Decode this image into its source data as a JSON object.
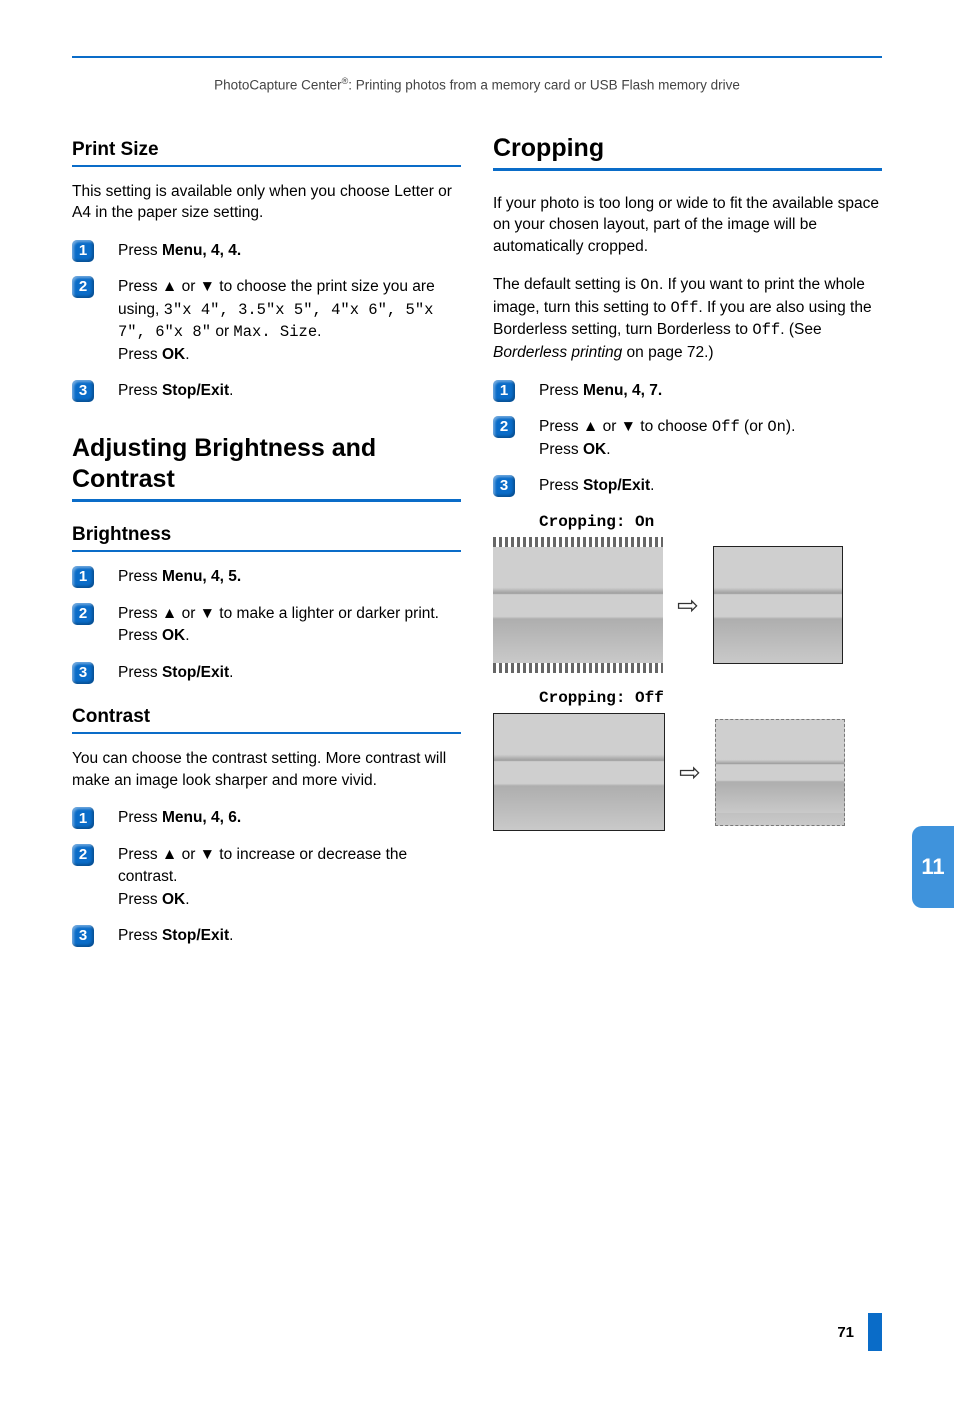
{
  "running_head": {
    "prefix": "PhotoCapture Center",
    "suffix": ": Printing photos from a memory card or USB Flash memory drive"
  },
  "side_tab": "11",
  "page_number": "71",
  "left": {
    "print_size": {
      "title": "Print Size",
      "intro": "This setting is available only when you choose Letter or A4 in the paper size setting.",
      "steps": {
        "s1": {
          "pre": "Press ",
          "menu": "Menu",
          "seq": ", 4, 4."
        },
        "s2": {
          "pre": "Press ▲ or ▼ to choose the print size you are using, ",
          "opts": "3\"x 4\", 3.5\"x 5\", 4\"x 6\", 5\"x 7\", 6\"x 8\"",
          "or": " or ",
          "last": "Max. Size",
          "post": ".",
          "ok_pre": "Press ",
          "ok": "OK",
          "ok_post": "."
        },
        "s3": {
          "pre": "Press ",
          "btn": "Stop/Exit",
          "post": "."
        }
      }
    },
    "adjust": {
      "title": "Adjusting Brightness and Contrast",
      "brightness": {
        "title": "Brightness",
        "steps": {
          "s1": {
            "pre": "Press ",
            "menu": "Menu",
            "seq": ", 4, 5."
          },
          "s2": {
            "text": "Press ▲ or ▼ to make a lighter or darker print.",
            "ok_pre": "Press ",
            "ok": "OK",
            "ok_post": "."
          },
          "s3": {
            "pre": "Press ",
            "btn": "Stop/Exit",
            "post": "."
          }
        }
      },
      "contrast": {
        "title": "Contrast",
        "intro": "You can choose the contrast setting. More contrast will make an image look sharper and more vivid.",
        "steps": {
          "s1": {
            "pre": "Press ",
            "menu": "Menu",
            "seq": ", 4, 6."
          },
          "s2": {
            "text": "Press ▲ or ▼ to increase or decrease the contrast.",
            "ok_pre": "Press ",
            "ok": "OK",
            "ok_post": "."
          },
          "s3": {
            "pre": "Press ",
            "btn": "Stop/Exit",
            "post": "."
          }
        }
      }
    }
  },
  "right": {
    "cropping": {
      "title": "Cropping",
      "p1": "If your photo is too long or wide to fit the available space on your chosen layout, part of the image will be automatically cropped.",
      "p2": {
        "a": "The default setting is ",
        "on": "On",
        "b": ". If you want to print the whole image, turn this setting to ",
        "off": "Off",
        "c": ". If you are also using the Borderless setting, turn Borderless to ",
        "off2": "Off",
        "d": ". (See ",
        "link": "Borderless printing",
        "e": " on page 72.)"
      },
      "steps": {
        "s1": {
          "pre": "Press ",
          "menu": "Menu",
          "seq": ", 4, 7."
        },
        "s2": {
          "pre": "Press ▲ or ▼ to choose ",
          "off": "Off",
          "mid": " (or ",
          "on": "On",
          "post": ").",
          "ok_pre": "Press ",
          "ok": "OK",
          "ok_post": "."
        },
        "s3": {
          "pre": "Press ",
          "btn": "Stop/Exit",
          "post": "."
        }
      },
      "labels": {
        "on": "Cropping: On",
        "off": "Cropping: Off"
      }
    }
  }
}
